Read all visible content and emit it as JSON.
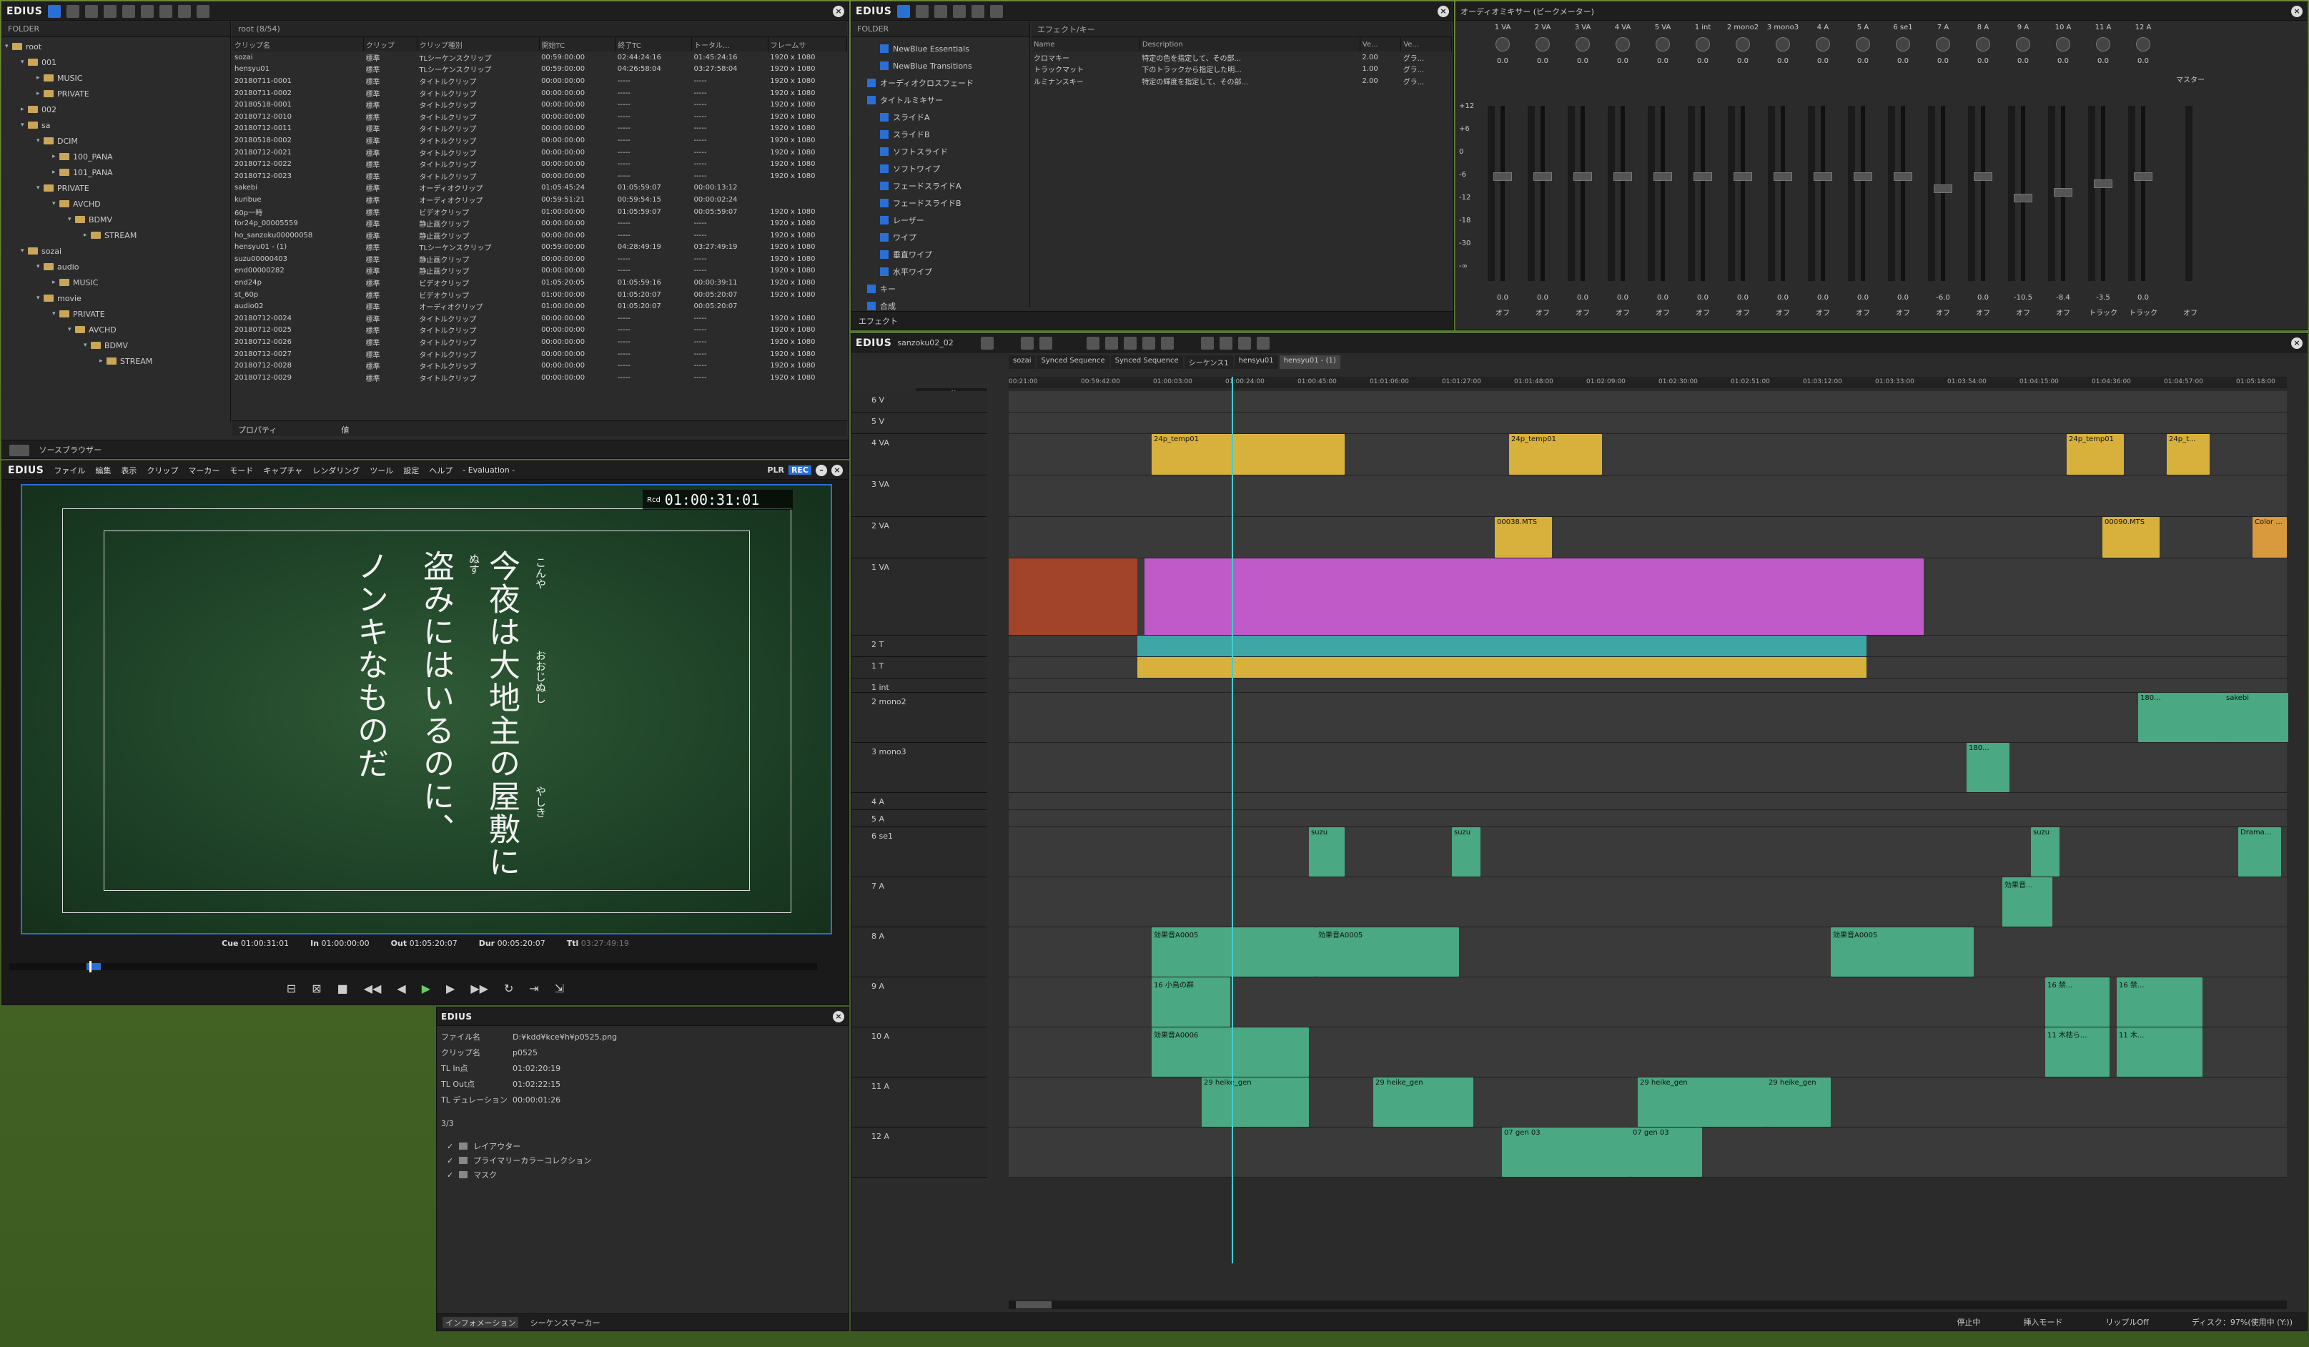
{
  "source_browser": {
    "brand": "EDIUS",
    "folder_label": "FOLDER",
    "root_label": "root (8/54)",
    "tree": [
      {
        "label": "root",
        "depth": 0,
        "open": true
      },
      {
        "label": "001",
        "depth": 1,
        "open": true
      },
      {
        "label": "MUSIC",
        "depth": 2,
        "open": false
      },
      {
        "label": "PRIVATE",
        "depth": 2,
        "open": false
      },
      {
        "label": "002",
        "depth": 1,
        "open": false
      },
      {
        "label": "sa",
        "depth": 1,
        "open": true
      },
      {
        "label": "DCIM",
        "depth": 2,
        "open": true
      },
      {
        "label": "100_PANA",
        "depth": 3,
        "open": false
      },
      {
        "label": "101_PANA",
        "depth": 3,
        "open": false
      },
      {
        "label": "PRIVATE",
        "depth": 2,
        "open": true
      },
      {
        "label": "AVCHD",
        "depth": 3,
        "open": true
      },
      {
        "label": "BDMV",
        "depth": 4,
        "open": true
      },
      {
        "label": "STREAM",
        "depth": 5,
        "open": false
      },
      {
        "label": "sozai",
        "depth": 1,
        "open": true
      },
      {
        "label": "audio",
        "depth": 2,
        "open": true
      },
      {
        "label": "MUSIC",
        "depth": 3,
        "open": false
      },
      {
        "label": "movie",
        "depth": 2,
        "open": true
      },
      {
        "label": "PRIVATE",
        "depth": 3,
        "open": true
      },
      {
        "label": "AVCHD",
        "depth": 4,
        "open": true
      },
      {
        "label": "BDMV",
        "depth": 5,
        "open": true
      },
      {
        "label": "STREAM",
        "depth": 6,
        "open": false
      }
    ],
    "columns": [
      "クリップ名",
      "クリップ",
      "クリップ種別",
      "開始TC",
      "終了TC",
      "トータル...",
      "フレームサ"
    ],
    "rows": [
      [
        "sozai",
        "標準",
        "TLシーケンスクリップ",
        "00:59:00:00",
        "02:44:24:16",
        "01:45:24:16",
        "1920 x 1080"
      ],
      [
        "hensyu01",
        "標準",
        "TLシーケンスクリップ",
        "00:59:00:00",
        "04:26:58:04",
        "03:27:58:04",
        "1920 x 1080"
      ],
      [
        "20180711-0001",
        "標準",
        "タイトルクリップ",
        "00:00:00:00",
        "-----",
        "-----",
        "1920 x 1080"
      ],
      [
        "20180711-0002",
        "標準",
        "タイトルクリップ",
        "00:00:00:00",
        "-----",
        "-----",
        "1920 x 1080"
      ],
      [
        "20180518-0001",
        "標準",
        "タイトルクリップ",
        "00:00:00:00",
        "-----",
        "-----",
        "1920 x 1080"
      ],
      [
        "20180712-0010",
        "標準",
        "タイトルクリップ",
        "00:00:00:00",
        "-----",
        "-----",
        "1920 x 1080"
      ],
      [
        "20180712-0011",
        "標準",
        "タイトルクリップ",
        "00:00:00:00",
        "-----",
        "-----",
        "1920 x 1080"
      ],
      [
        "20180518-0002",
        "標準",
        "タイトルクリップ",
        "00:00:00:00",
        "-----",
        "-----",
        "1920 x 1080"
      ],
      [
        "20180712-0021",
        "標準",
        "タイトルクリップ",
        "00:00:00:00",
        "-----",
        "-----",
        "1920 x 1080"
      ],
      [
        "20180712-0022",
        "標準",
        "タイトルクリップ",
        "00:00:00:00",
        "-----",
        "-----",
        "1920 x 1080"
      ],
      [
        "20180712-0023",
        "標準",
        "タイトルクリップ",
        "00:00:00:00",
        "-----",
        "-----",
        "1920 x 1080"
      ],
      [
        "sakebi",
        "標準",
        "オーディオクリップ",
        "01:05:45:24",
        "01:05:59:07",
        "00:00:13:12",
        ""
      ],
      [
        "kuribue",
        "標準",
        "オーディオクリップ",
        "00:59:51:21",
        "00:59:54:15",
        "00:00:02:24",
        ""
      ],
      [
        "60p一時",
        "標準",
        "ビデオクリップ",
        "01:00:00:00",
        "01:05:59:07",
        "00:05:59:07",
        "1920 x 1080"
      ],
      [
        "for24p_00005559",
        "標準",
        "静止画クリップ",
        "00:00:00:00",
        "-----",
        "-----",
        "1920 x 1080"
      ],
      [
        "ho_sanzoku00000058",
        "標準",
        "静止画クリップ",
        "00:00:00:00",
        "-----",
        "-----",
        "1920 x 1080"
      ],
      [
        "hensyu01 - (1)",
        "標準",
        "TLシーケンスクリップ",
        "00:59:00:00",
        "04:28:49:19",
        "03:27:49:19",
        "1920 x 1080"
      ],
      [
        "suzu00000403",
        "標準",
        "静止画クリップ",
        "00:00:00:00",
        "-----",
        "-----",
        "1920 x 1080"
      ],
      [
        "end00000282",
        "標準",
        "静止画クリップ",
        "00:00:00:00",
        "-----",
        "-----",
        "1920 x 1080"
      ],
      [
        "end24p",
        "標準",
        "ビデオクリップ",
        "01:05:20:05",
        "01:05:59:16",
        "00:00:39:11",
        "1920 x 1080"
      ],
      [
        "st_60p",
        "標準",
        "ビデオクリップ",
        "01:00:00:00",
        "01:05:20:07",
        "00:05:20:07",
        "1920 x 1080"
      ],
      [
        "audio02",
        "標準",
        "オーディオクリップ",
        "01:00:00:00",
        "01:05:20:07",
        "00:05:20:07",
        ""
      ],
      [
        "20180712-0024",
        "標準",
        "タイトルクリップ",
        "00:00:00:00",
        "-----",
        "-----",
        "1920 x 1080"
      ],
      [
        "20180712-0025",
        "標準",
        "タイトルクリップ",
        "00:00:00:00",
        "-----",
        "-----",
        "1920 x 1080"
      ],
      [
        "20180712-0026",
        "標準",
        "タイトルクリップ",
        "00:00:00:00",
        "-----",
        "-----",
        "1920 x 1080"
      ],
      [
        "20180712-0027",
        "標準",
        "タイトルクリップ",
        "00:00:00:00",
        "-----",
        "-----",
        "1920 x 1080"
      ],
      [
        "20180712-0028",
        "標準",
        "タイトルクリップ",
        "00:00:00:00",
        "-----",
        "-----",
        "1920 x 1080"
      ],
      [
        "20180712-0029",
        "標準",
        "タイトルクリップ",
        "00:00:00:00",
        "-----",
        "-----",
        "1920 x 1080"
      ]
    ],
    "property_label": "プロパティ",
    "value_label": "値",
    "tab_label": "ソースブラウザー"
  },
  "effects": {
    "brand": "EDIUS",
    "folder_label": "FOLDER",
    "path_label": "エフェクト/キー",
    "tree": [
      {
        "label": "NewBlue Essentials",
        "depth": 2
      },
      {
        "label": "NewBlue Transitions",
        "depth": 2
      },
      {
        "label": "オーディオクロスフェード",
        "depth": 1
      },
      {
        "label": "タイトルミキサー",
        "depth": 1
      },
      {
        "label": "スライドA",
        "depth": 2
      },
      {
        "label": "スライドB",
        "depth": 2
      },
      {
        "label": "ソフトスライド",
        "depth": 2
      },
      {
        "label": "ソフトワイプ",
        "depth": 2
      },
      {
        "label": "フェードスライドA",
        "depth": 2
      },
      {
        "label": "フェードスライドB",
        "depth": 2
      },
      {
        "label": "レーザー",
        "depth": 2
      },
      {
        "label": "ワイプ",
        "depth": 2
      },
      {
        "label": "垂直ワイプ",
        "depth": 2
      },
      {
        "label": "水平ワイプ",
        "depth": 2
      },
      {
        "label": "キー",
        "depth": 1
      },
      {
        "label": "合成",
        "depth": 1
      }
    ],
    "columns": [
      "Name",
      "Description",
      "Ve...",
      "Ve..."
    ],
    "rows": [
      [
        "クロマキー",
        "特定の色を指定して、その部...",
        "2.00",
        "グラ..."
      ],
      [
        "トラックマット",
        "下のトラックから指定した明...",
        "1.00",
        "グラ..."
      ],
      [
        "ルミナンスキー",
        "特定の輝度を指定して、その部...",
        "2.00",
        "グラ..."
      ]
    ],
    "tab_label": "エフェクト"
  },
  "mixer": {
    "title": "オーディオミキサー (ピークメーター)",
    "channels": [
      "1 VA",
      "2 VA",
      "3 VA",
      "4 VA",
      "5 VA",
      "1 int",
      "2 mono2",
      "3 mono3",
      "4 A",
      "5 A",
      "6 se1",
      "7 A",
      "8 A",
      "9 A",
      "10 A",
      "11 A",
      "12 A"
    ],
    "master_label": "マスター",
    "scale": [
      "+12",
      "+6",
      "0",
      "-6",
      "-12",
      "-18",
      "-30",
      "-∞"
    ],
    "pan_values": [
      "0.0",
      "0.0",
      "0.0",
      "0.0",
      "0.0",
      "0.0",
      "0.0",
      "0.0",
      "0.0",
      "0.0",
      "0.0",
      "0.0",
      "0.0",
      "0.0",
      "0.0",
      "0.0",
      "0.0"
    ],
    "fader_db": [
      "0.0",
      "0.0",
      "0.0",
      "0.0",
      "0.0",
      "0.0",
      "0.0",
      "0.0",
      "0.0",
      "0.0",
      "0.0",
      "-6.0",
      "0.0",
      "-10.5",
      "-8.4",
      "-3.5",
      "0.0"
    ],
    "fader_levels": [
      0.62,
      0.62,
      0.62,
      0.62,
      0.62,
      0.62,
      0.62,
      0.62,
      0.62,
      0.62,
      0.62,
      0.55,
      0.62,
      0.5,
      0.53,
      0.58,
      0.62
    ],
    "mode_labels": [
      "オフ",
      "オフ",
      "オフ",
      "オフ",
      "オフ",
      "オフ",
      "オフ",
      "オフ",
      "オフ",
      "オフ",
      "オフ",
      "オフ",
      "オフ",
      "オフ",
      "オフ",
      "トラック",
      "トラック"
    ],
    "master_mode": "オフ"
  },
  "player": {
    "brand": "EDIUS",
    "menu": [
      "ファイル",
      "編集",
      "表示",
      "クリップ",
      "マーカー",
      "モード",
      "キャプチャ",
      "レンダリング",
      "ツール",
      "設定",
      "ヘルプ"
    ],
    "eval": "- Evaluation -",
    "plr": "PLR",
    "rec": "REC",
    "timecode": "01:00:31:01",
    "tc_label": "Rcd",
    "lines": [
      "今夜は大地主の屋敷に",
      "盗みにはいるのに、",
      "ノンキなものだ"
    ],
    "ruby": [
      "こんや",
      "おおじぬし",
      "やしき",
      "ぬす"
    ],
    "cue_label": "Cue",
    "cue": "01:00:31:01",
    "in_label": "In",
    "in": "01:00:00:00",
    "out_label": "Out",
    "out": "01:05:20:07",
    "dur_label": "Dur",
    "dur": "00:05:20:07",
    "ttl_label": "Ttl",
    "ttl": "03:27:49:19"
  },
  "info": {
    "brand": "EDIUS",
    "fields": [
      {
        "label": "ファイル名",
        "value": "D:¥kdd¥kce¥h¥p0525.png"
      },
      {
        "label": "クリップ名",
        "value": "p0525"
      },
      {
        "label": "TL In点",
        "value": "01:02:20:19"
      },
      {
        "label": "TL Out点",
        "value": "01:02:22:15"
      },
      {
        "label": "TL デュレーション",
        "value": "00:00:01:26"
      }
    ],
    "count": "3/3",
    "filters": [
      "レイアウター",
      "プライマリーカラーコレクション",
      "マスク"
    ],
    "tabs": [
      "インフォメーション",
      "シーケンスマーカー"
    ]
  },
  "timeline": {
    "brand": "EDIUS",
    "project": "sanzoku02_02",
    "tabs": [
      "sozai",
      "Synced Sequence",
      "Synced Sequence",
      "シーケンス1",
      "hensyu01",
      "hensyu01 - (1)"
    ],
    "zoom": "5秒",
    "ruler": [
      "00:21:00",
      "00:59:42:00",
      "01:00:03:00",
      "01:00:24:00",
      "01:00:45:00",
      "01:01:06:00",
      "01:01:27:00",
      "01:01:48:00",
      "01:02:09:00",
      "01:02:30:00",
      "01:02:51:00",
      "01:03:12:00",
      "01:03:33:00",
      "01:03:54:00",
      "01:04:15:00",
      "01:04:36:00",
      "01:04:57:00",
      "01:05:18:00"
    ],
    "tracks": [
      {
        "name": "6 V",
        "h": 30
      },
      {
        "name": "5 V",
        "h": 30
      },
      {
        "name": "4 VA",
        "h": 58
      },
      {
        "name": "3 VA",
        "h": 58
      },
      {
        "name": "2 VA",
        "h": 58
      },
      {
        "name": "1 VA",
        "h": 108
      },
      {
        "name": "2 T",
        "h": 30
      },
      {
        "name": "1 T",
        "h": 30
      },
      {
        "name": "1 int",
        "h": 20
      },
      {
        "name": "2 mono2",
        "h": 70
      },
      {
        "name": "3 mono3",
        "h": 70
      },
      {
        "name": "4 A",
        "h": 24
      },
      {
        "name": "5 A",
        "h": 24
      },
      {
        "name": "6 se1",
        "h": 70
      },
      {
        "name": "7 A",
        "h": 70
      },
      {
        "name": "8 A",
        "h": 70
      },
      {
        "name": "9 A",
        "h": 70
      },
      {
        "name": "10 A",
        "h": 70
      },
      {
        "name": "11 A",
        "h": 70
      },
      {
        "name": "12 A",
        "h": 70
      }
    ],
    "clips_labels": {
      "c4va_1": "24p_temp01",
      "c4va_2": "24p_temp01",
      "c4va_3": "24p_temp01",
      "c4va_4": "24p_t...",
      "c2va_1": "00038.MTS",
      "c2va_2": "00090.MTS",
      "c2va_3": "Color ...",
      "c8a_1": "効果音A0005",
      "c8a_2": "効果音A0005",
      "c8a_3": "効果音A0005",
      "c9a_1": "16 小鳥の群",
      "c9a_2": "16 禁...",
      "c9a_3": "16 禁...",
      "c10a_1": "効果音A0006",
      "c10a_2": "11 木枯ら...",
      "c10a_3": "11 木...",
      "c11a_1": "29 heike_gen",
      "c11a_2": "29 heike_gen",
      "c11a_3": "29 heike_gen",
      "c11a_4": "29 heike_gen",
      "c12a_1": "07 gen 03",
      "c12a_2": "07 gen 03",
      "c6se_1": "suzu",
      "c6se_2": "suzu",
      "c6se_3": "suzu",
      "c6se_4": "Drama...",
      "c7a_1": "効果音...",
      "c2m_1": "180...",
      "c2m_2": "sakebi",
      "c3m_1": "180..."
    },
    "status": [
      "停止中",
      "挿入モード",
      "リップルOff",
      "ディスク：97%(使用中 (Y:))"
    ]
  }
}
